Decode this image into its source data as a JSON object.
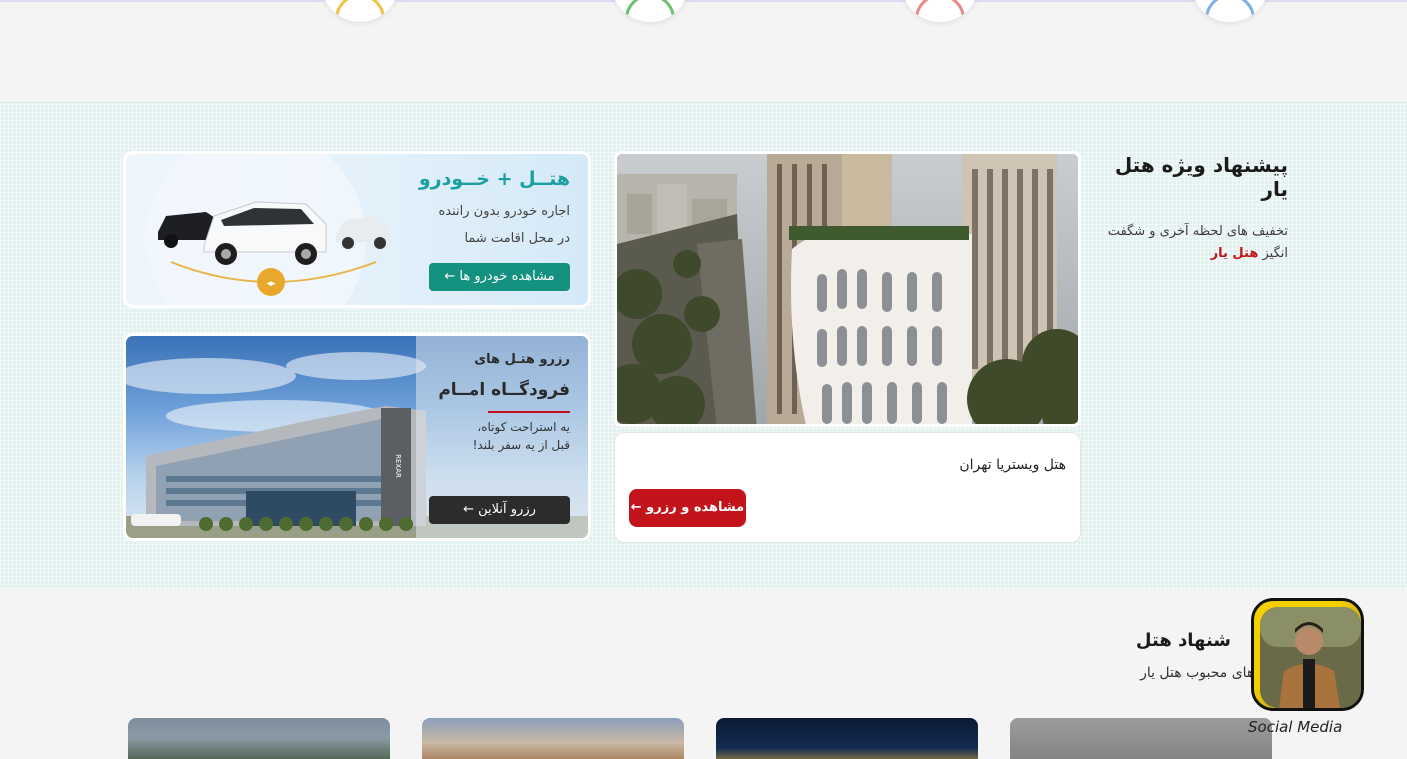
{
  "offer": {
    "title": "پیشنهاد ویژه هتل یار",
    "subtitle_pre": "تخفیف های لحظه آخری و شگفت انگیز ",
    "subtitle_brand": "هتل یار"
  },
  "featured_hotel": {
    "name": "هتل ویستریا تهران",
    "button": "مشاهده و رزرو ←"
  },
  "car_promo": {
    "title": "هتــل + خــودرو",
    "line1": "اجاره خودرو بدون راننده",
    "line2": "در محل اقامت شما",
    "button": "مشاهده خودرو ها ←"
  },
  "airport_promo": {
    "line1": "رزرو هتـل های",
    "line2": "فرودگــاه امــام",
    "line3": "یه استراحت کوتاه،",
    "line4": "قبل از یه سفر بلند!",
    "button": "رزرو آنلاین ←",
    "hotel_sign": "REXAR"
  },
  "suggestions": {
    "title": "شنهاد هتل",
    "subtitle": "هتل های محبوب هتل یار"
  },
  "social": {
    "label": "Social Media"
  },
  "colors": {
    "brand_red": "#c3141b",
    "teal": "#14927f",
    "band_bg": "#e4f1f1"
  }
}
